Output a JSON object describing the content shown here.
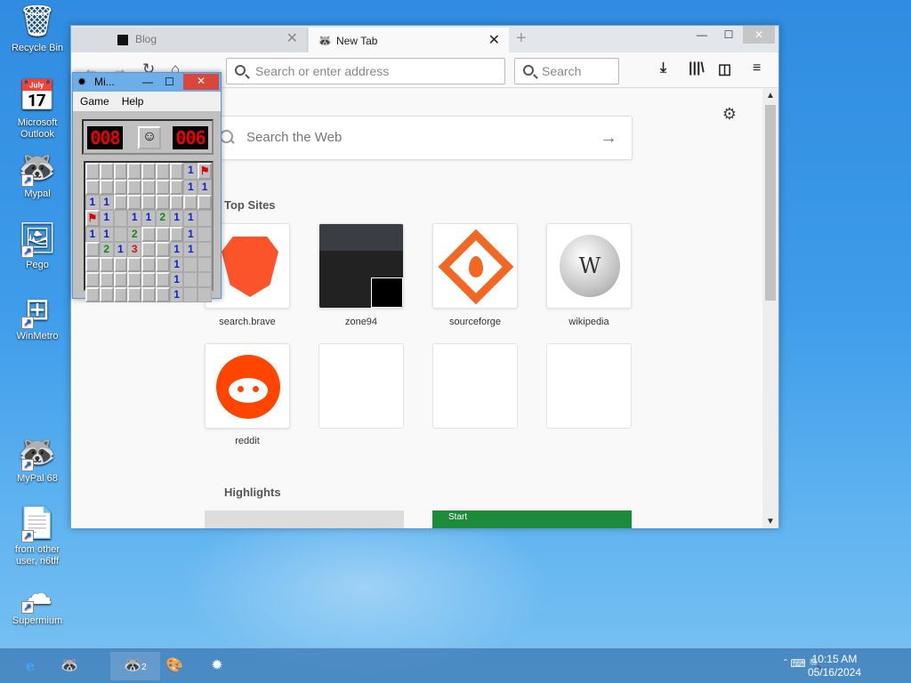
{
  "desktop": {
    "icons": [
      {
        "label": "Recycle Bin",
        "icon": "recycle-bin-icon"
      },
      {
        "label": "Microsoft Outlook",
        "icon": "outlook-icon"
      },
      {
        "label": "Mypal",
        "icon": "mypal-icon"
      },
      {
        "label": "Pego",
        "icon": "pego-icon"
      },
      {
        "label": "WinMetro",
        "icon": "winmetro-icon"
      },
      {
        "label": "MyPal 68",
        "icon": "mypal68-icon"
      },
      {
        "label": "from other user, n6tff",
        "icon": "document-icon"
      },
      {
        "label": "Supermium",
        "icon": "supermium-icon"
      }
    ]
  },
  "browser": {
    "tabs": [
      {
        "label": "Blog",
        "active": false
      },
      {
        "label": "New Tab",
        "active": true
      }
    ],
    "url_placeholder": "Search or enter address",
    "search_placeholder": "Search",
    "web_search_placeholder": "Search the Web",
    "top_sites_heading": "Top Sites",
    "highlights_heading": "Highlights",
    "top_sites": [
      {
        "label": "search.brave",
        "color": "#fb542b"
      },
      {
        "label": "zone94",
        "color": "#333333"
      },
      {
        "label": "sourceforge",
        "color": "#f26722"
      },
      {
        "label": "wikipedia",
        "color": "#666666"
      },
      {
        "label": "reddit",
        "color": "#ff4500"
      }
    ],
    "highlight_card_label": "Start"
  },
  "minesweeper": {
    "title": "Mi...",
    "menu": [
      "Game",
      "Help"
    ],
    "mines_left": "008",
    "timer": "006",
    "grid": [
      [
        "c",
        "c",
        "c",
        "c",
        "c",
        "c",
        "c",
        "1",
        "F"
      ],
      [
        "c",
        "c",
        "c",
        "c",
        "c",
        "c",
        "c",
        "1",
        "1"
      ],
      [
        "1",
        "1",
        "c",
        "c",
        "c",
        "c",
        "c",
        "c",
        "c"
      ],
      [
        "F",
        "1",
        "",
        "1",
        "1",
        "2",
        "1",
        "1",
        ""
      ],
      [
        "1",
        "1",
        "",
        "2",
        "c",
        "c",
        "c",
        "1",
        ""
      ],
      [
        "c",
        "2",
        "1",
        "3",
        "c",
        "c",
        "1",
        "1",
        ""
      ],
      [
        "c",
        "c",
        "c",
        "c",
        "c",
        "c",
        "1",
        "",
        ""
      ],
      [
        "c",
        "c",
        "c",
        "c",
        "c",
        "c",
        "1",
        "",
        ""
      ],
      [
        "c",
        "c",
        "c",
        "c",
        "c",
        "c",
        "1",
        "",
        ""
      ]
    ]
  },
  "taskbar": {
    "time": "10:15 AM",
    "date": "05/16/2024",
    "group_count": "2"
  }
}
